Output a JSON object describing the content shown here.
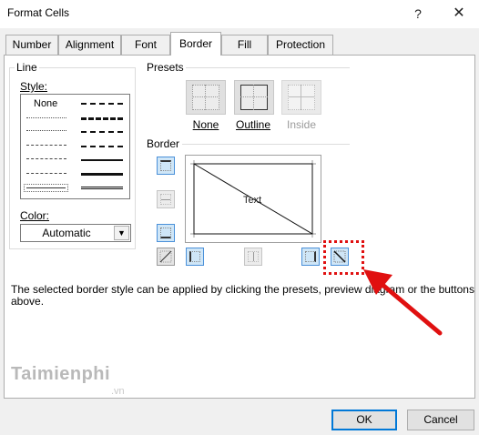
{
  "dialog": {
    "title": "Format Cells",
    "help_glyph": "?",
    "close_glyph": "✕"
  },
  "tabs": [
    {
      "label": "Number",
      "active": false
    },
    {
      "label": "Alignment",
      "active": false
    },
    {
      "label": "Font",
      "active": false
    },
    {
      "label": "Border",
      "active": true
    },
    {
      "label": "Fill",
      "active": false
    },
    {
      "label": "Protection",
      "active": false
    }
  ],
  "line_group": {
    "title": "Line",
    "style_label": "Style:",
    "none_label": "None",
    "color_label": "Color:",
    "color_value": "Automatic"
  },
  "presets": {
    "title": "Presets",
    "items": [
      {
        "label": "None",
        "enabled": true
      },
      {
        "label": "Outline",
        "enabled": true
      },
      {
        "label": "Inside",
        "enabled": false
      }
    ]
  },
  "border": {
    "title": "Border",
    "preview_text": "Text"
  },
  "description": "The selected border style can be applied by clicking the presets, preview diagram or the buttons above.",
  "watermark": {
    "brand": "Taimienphi",
    "suffix": ".vn"
  },
  "buttons": {
    "ok": "OK",
    "cancel": "Cancel"
  },
  "annotation": {
    "color": "#e01010"
  }
}
